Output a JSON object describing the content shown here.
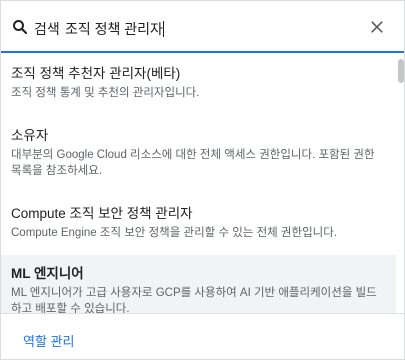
{
  "search": {
    "prefix": "검색",
    "query": "조직 정책 관리자",
    "icon": "search-icon",
    "close_icon": "close-icon",
    "accent_color": "#1a73e8"
  },
  "items": [
    {
      "title": "조직 정책 추천자 관리자(베타)",
      "description": "조직 정책 통계 및 추천의 관리자입니다."
    },
    {
      "title": "소유자",
      "description": "대부분의 Google Cloud 리소스에 대한 전체 액세스 권한입니다. 포함된 권한 목록을 참조하세요."
    },
    {
      "title": "Compute 조직 보안 정책 관리자",
      "description": "Compute Engine 조직 보안 정책을 관리할 수 있는 전체 권한입니다."
    },
    {
      "title": "ML 엔지니어",
      "description": "ML 엔지니어가 고급 사용자로 GCP를 사용하여 AI 기반 애플리케이션을 빌드하고 배포할 수 있습니다."
    }
  ],
  "footer": {
    "manage_roles_label": "역할 관리"
  }
}
